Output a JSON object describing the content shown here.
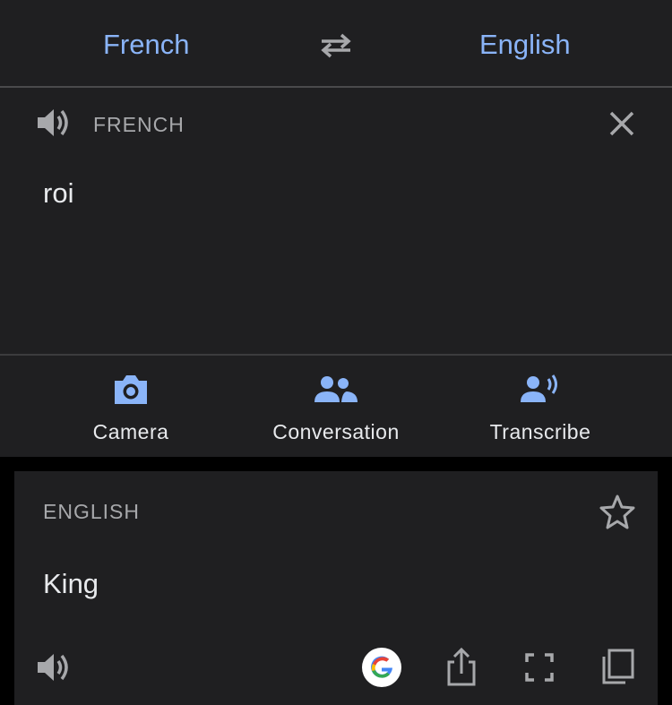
{
  "language_bar": {
    "source_language": "French",
    "target_language": "English",
    "swap_icon": "swap-arrows-icon"
  },
  "input": {
    "language_caption": "FRENCH",
    "text": "roi"
  },
  "tools": {
    "camera_label": "Camera",
    "conversation_label": "Conversation",
    "transcribe_label": "Transcribe"
  },
  "result": {
    "language_caption": "ENGLISH",
    "text": "King"
  },
  "colors": {
    "accent": "#8ab4f8",
    "panel": "#1f1f21",
    "background": "#000000",
    "text": "#e8eaed",
    "caption": "#a7a8ab"
  }
}
